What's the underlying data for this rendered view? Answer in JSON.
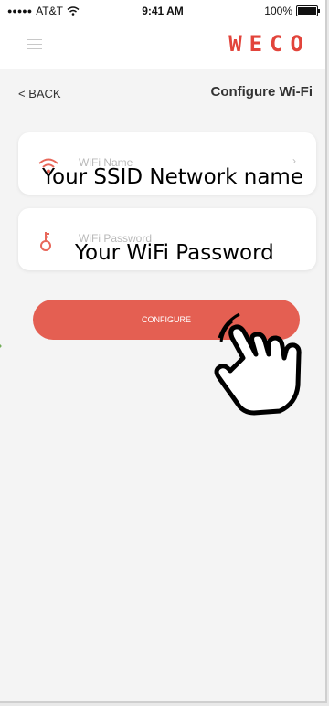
{
  "status_bar": {
    "carrier": "AT&T",
    "time": "9:41 AM",
    "battery": "100%"
  },
  "header": {
    "logo": "WECO"
  },
  "nav": {
    "back_label": "< BACK",
    "title": "Configure Wi-Fi"
  },
  "wifi_name": {
    "placeholder": "WiFi Name",
    "overlay": "Your SSID Network name",
    "chevron": "›"
  },
  "wifi_password": {
    "placeholder": "WiFi Password",
    "overlay": "Your WiFi Password"
  },
  "configure": {
    "label": "CONFIGURE"
  },
  "colors": {
    "accent": "#e2443b",
    "button": "#e45f52",
    "icon": "#e8675a"
  }
}
